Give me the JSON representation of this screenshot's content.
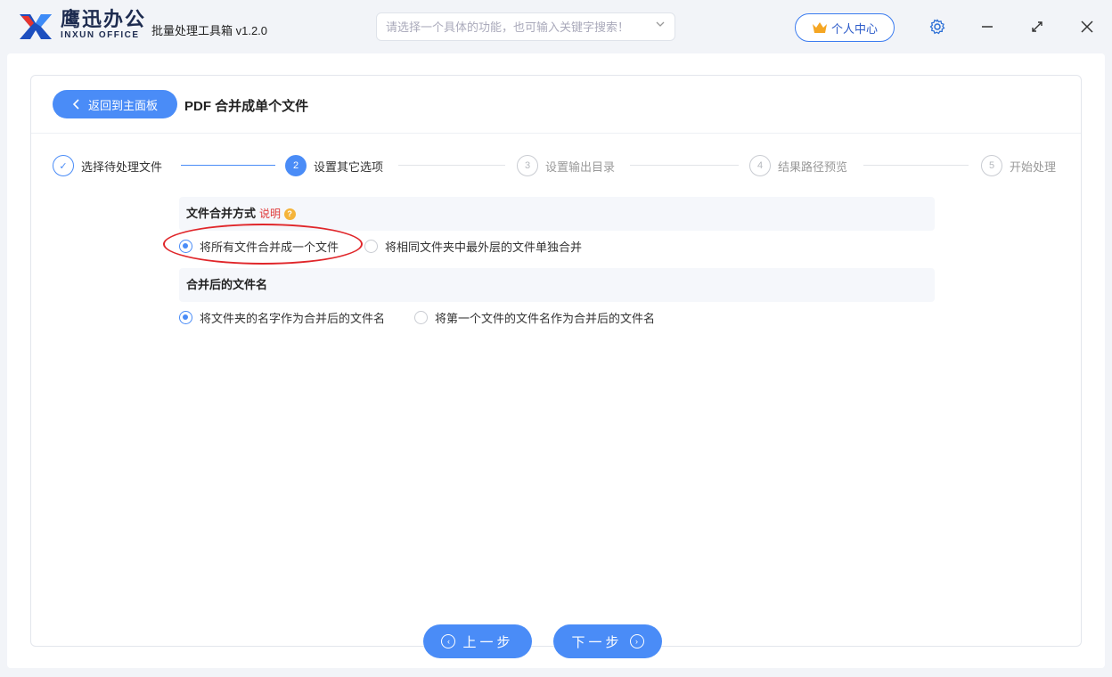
{
  "titlebar": {
    "brand_cn": "鹰迅办公",
    "brand_en": "INXUN OFFICE",
    "app_name": "批量处理工具箱 v1.2.0",
    "search_placeholder": "请选择一个具体的功能，也可输入关键字搜索！",
    "user_center": "个人中心"
  },
  "header": {
    "back_label": "返回到主面板",
    "title": "PDF 合并成单个文件"
  },
  "steps": [
    {
      "num": "✓",
      "label": "选择待处理文件",
      "state": "done"
    },
    {
      "num": "2",
      "label": "设置其它选项",
      "state": "active"
    },
    {
      "num": "3",
      "label": "设置输出目录",
      "state": "todo"
    },
    {
      "num": "4",
      "label": "结果路径预览",
      "state": "todo"
    },
    {
      "num": "5",
      "label": "开始处理",
      "state": "todo"
    }
  ],
  "merge_mode": {
    "title": "文件合并方式",
    "help": "说明",
    "options": [
      {
        "label": "将所有文件合并成一个文件",
        "selected": true
      },
      {
        "label": "将相同文件夹中最外层的文件单独合并",
        "selected": false
      }
    ]
  },
  "merged_name": {
    "title": "合并后的文件名",
    "options": [
      {
        "label": "将文件夹的名字作为合并后的文件名",
        "selected": true
      },
      {
        "label": "将第一个文件的文件名作为合并后的文件名",
        "selected": false
      }
    ]
  },
  "nav": {
    "prev": "上一步",
    "next": "下一步"
  },
  "colors": {
    "accent": "#4a8cf7",
    "annotation": "#e0262a"
  }
}
